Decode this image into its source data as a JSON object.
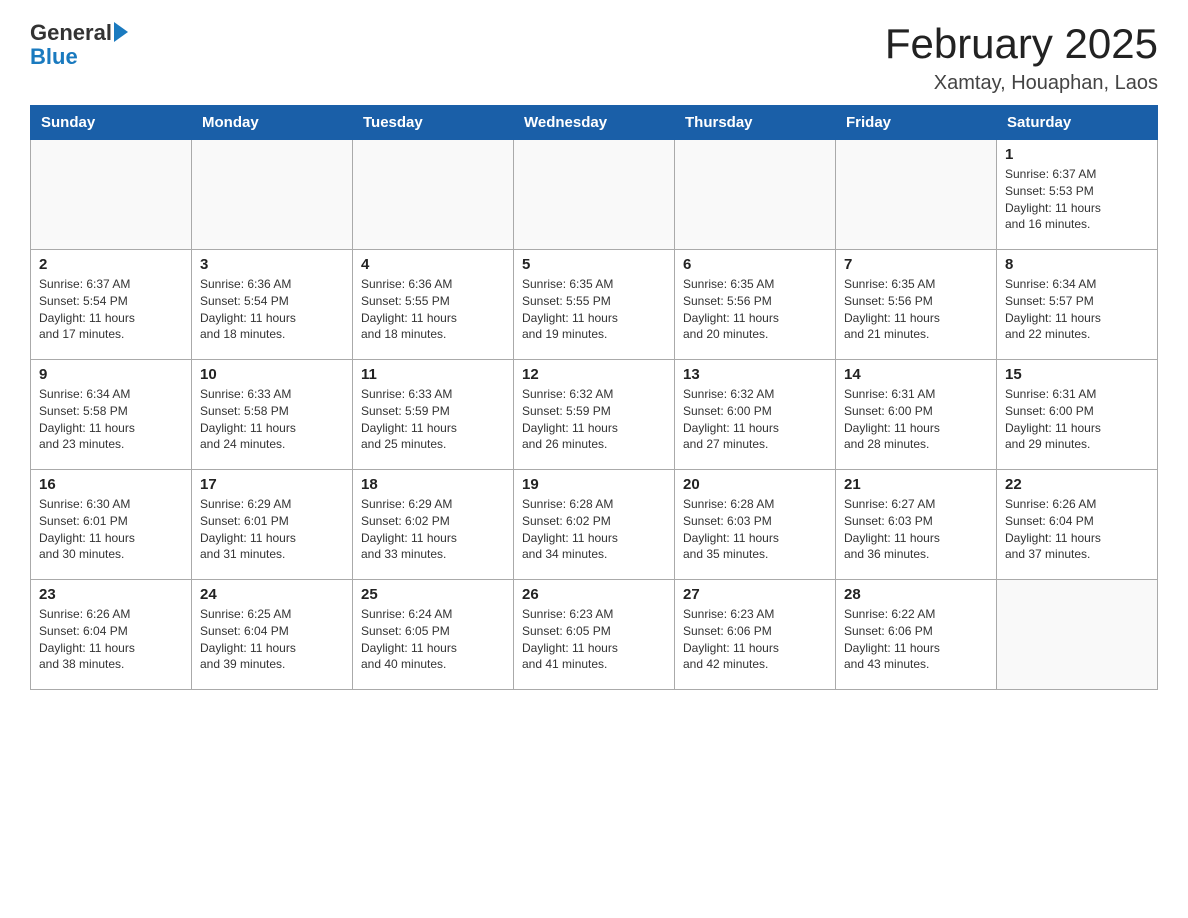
{
  "header": {
    "logo_general": "General",
    "logo_blue": "Blue",
    "title": "February 2025",
    "subtitle": "Xamtay, Houaphan, Laos"
  },
  "weekdays": [
    "Sunday",
    "Monday",
    "Tuesday",
    "Wednesday",
    "Thursday",
    "Friday",
    "Saturday"
  ],
  "weeks": [
    [
      {
        "day": "",
        "info": ""
      },
      {
        "day": "",
        "info": ""
      },
      {
        "day": "",
        "info": ""
      },
      {
        "day": "",
        "info": ""
      },
      {
        "day": "",
        "info": ""
      },
      {
        "day": "",
        "info": ""
      },
      {
        "day": "1",
        "info": "Sunrise: 6:37 AM\nSunset: 5:53 PM\nDaylight: 11 hours\nand 16 minutes."
      }
    ],
    [
      {
        "day": "2",
        "info": "Sunrise: 6:37 AM\nSunset: 5:54 PM\nDaylight: 11 hours\nand 17 minutes."
      },
      {
        "day": "3",
        "info": "Sunrise: 6:36 AM\nSunset: 5:54 PM\nDaylight: 11 hours\nand 18 minutes."
      },
      {
        "day": "4",
        "info": "Sunrise: 6:36 AM\nSunset: 5:55 PM\nDaylight: 11 hours\nand 18 minutes."
      },
      {
        "day": "5",
        "info": "Sunrise: 6:35 AM\nSunset: 5:55 PM\nDaylight: 11 hours\nand 19 minutes."
      },
      {
        "day": "6",
        "info": "Sunrise: 6:35 AM\nSunset: 5:56 PM\nDaylight: 11 hours\nand 20 minutes."
      },
      {
        "day": "7",
        "info": "Sunrise: 6:35 AM\nSunset: 5:56 PM\nDaylight: 11 hours\nand 21 minutes."
      },
      {
        "day": "8",
        "info": "Sunrise: 6:34 AM\nSunset: 5:57 PM\nDaylight: 11 hours\nand 22 minutes."
      }
    ],
    [
      {
        "day": "9",
        "info": "Sunrise: 6:34 AM\nSunset: 5:58 PM\nDaylight: 11 hours\nand 23 minutes."
      },
      {
        "day": "10",
        "info": "Sunrise: 6:33 AM\nSunset: 5:58 PM\nDaylight: 11 hours\nand 24 minutes."
      },
      {
        "day": "11",
        "info": "Sunrise: 6:33 AM\nSunset: 5:59 PM\nDaylight: 11 hours\nand 25 minutes."
      },
      {
        "day": "12",
        "info": "Sunrise: 6:32 AM\nSunset: 5:59 PM\nDaylight: 11 hours\nand 26 minutes."
      },
      {
        "day": "13",
        "info": "Sunrise: 6:32 AM\nSunset: 6:00 PM\nDaylight: 11 hours\nand 27 minutes."
      },
      {
        "day": "14",
        "info": "Sunrise: 6:31 AM\nSunset: 6:00 PM\nDaylight: 11 hours\nand 28 minutes."
      },
      {
        "day": "15",
        "info": "Sunrise: 6:31 AM\nSunset: 6:00 PM\nDaylight: 11 hours\nand 29 minutes."
      }
    ],
    [
      {
        "day": "16",
        "info": "Sunrise: 6:30 AM\nSunset: 6:01 PM\nDaylight: 11 hours\nand 30 minutes."
      },
      {
        "day": "17",
        "info": "Sunrise: 6:29 AM\nSunset: 6:01 PM\nDaylight: 11 hours\nand 31 minutes."
      },
      {
        "day": "18",
        "info": "Sunrise: 6:29 AM\nSunset: 6:02 PM\nDaylight: 11 hours\nand 33 minutes."
      },
      {
        "day": "19",
        "info": "Sunrise: 6:28 AM\nSunset: 6:02 PM\nDaylight: 11 hours\nand 34 minutes."
      },
      {
        "day": "20",
        "info": "Sunrise: 6:28 AM\nSunset: 6:03 PM\nDaylight: 11 hours\nand 35 minutes."
      },
      {
        "day": "21",
        "info": "Sunrise: 6:27 AM\nSunset: 6:03 PM\nDaylight: 11 hours\nand 36 minutes."
      },
      {
        "day": "22",
        "info": "Sunrise: 6:26 AM\nSunset: 6:04 PM\nDaylight: 11 hours\nand 37 minutes."
      }
    ],
    [
      {
        "day": "23",
        "info": "Sunrise: 6:26 AM\nSunset: 6:04 PM\nDaylight: 11 hours\nand 38 minutes."
      },
      {
        "day": "24",
        "info": "Sunrise: 6:25 AM\nSunset: 6:04 PM\nDaylight: 11 hours\nand 39 minutes."
      },
      {
        "day": "25",
        "info": "Sunrise: 6:24 AM\nSunset: 6:05 PM\nDaylight: 11 hours\nand 40 minutes."
      },
      {
        "day": "26",
        "info": "Sunrise: 6:23 AM\nSunset: 6:05 PM\nDaylight: 11 hours\nand 41 minutes."
      },
      {
        "day": "27",
        "info": "Sunrise: 6:23 AM\nSunset: 6:06 PM\nDaylight: 11 hours\nand 42 minutes."
      },
      {
        "day": "28",
        "info": "Sunrise: 6:22 AM\nSunset: 6:06 PM\nDaylight: 11 hours\nand 43 minutes."
      },
      {
        "day": "",
        "info": ""
      }
    ]
  ]
}
